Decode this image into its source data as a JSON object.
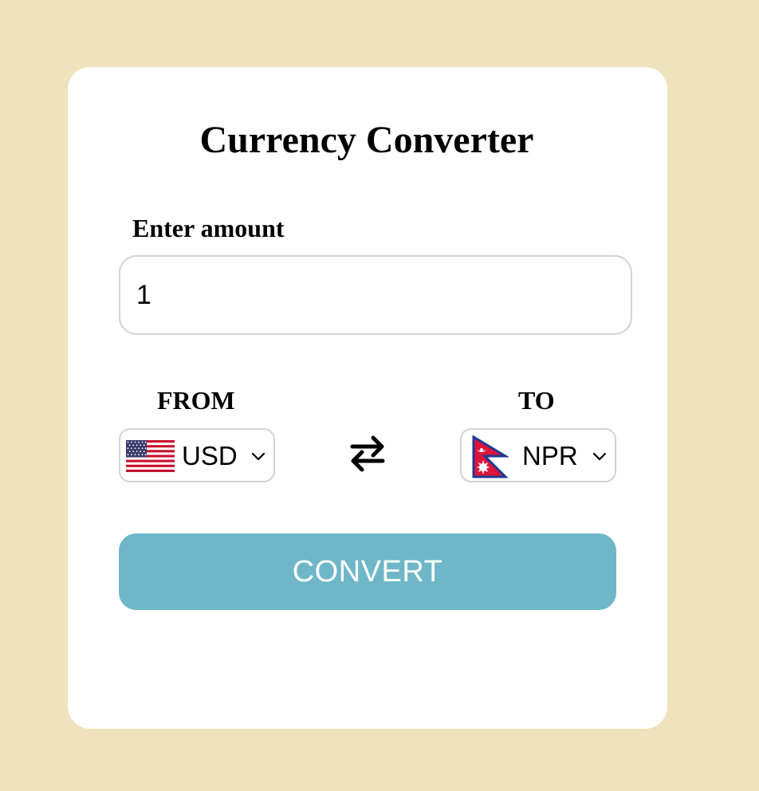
{
  "title": "Currency Converter",
  "amount": {
    "label": "Enter amount",
    "value": "1"
  },
  "from": {
    "label": "FROM",
    "currency": "USD",
    "flag_icon": "us-flag-icon"
  },
  "to": {
    "label": "TO",
    "currency": "NPR",
    "flag_icon": "nepal-flag-icon"
  },
  "swap_icon": "swap-arrows-icon",
  "convert_label": "CONVERT",
  "colors": {
    "background": "#efe3bd",
    "card": "#ffffff",
    "button": "#6fb7c8",
    "button_text": "#ffffff",
    "border": "#d3d3d3"
  }
}
